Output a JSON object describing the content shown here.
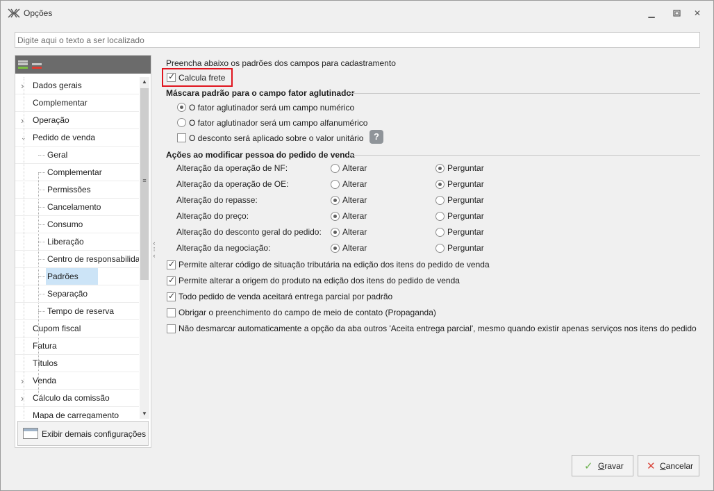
{
  "window": {
    "title": "Opções",
    "colors": {
      "accent_selection": "#cce4f7",
      "highlight_border": "#e0141e",
      "save_check": "#6ab04c",
      "cancel_x": "#d9463b"
    }
  },
  "search": {
    "placeholder": "Digite aqui o texto a ser localizado"
  },
  "tree": {
    "items": [
      {
        "label": "Dados gerais",
        "level": 0,
        "expandable": true
      },
      {
        "label": "Complementar",
        "level": 0,
        "expandable": false
      },
      {
        "label": "Operação",
        "level": 0,
        "expandable": true
      },
      {
        "label": "Pedido de venda",
        "level": 0,
        "expandable": true,
        "expanded": true
      },
      {
        "label": "Geral",
        "level": 1
      },
      {
        "label": "Complementar",
        "level": 1
      },
      {
        "label": "Permissões",
        "level": 1
      },
      {
        "label": "Cancelamento",
        "level": 1
      },
      {
        "label": "Consumo",
        "level": 1
      },
      {
        "label": "Liberação",
        "level": 1
      },
      {
        "label": "Centro de responsabilidade",
        "level": 1
      },
      {
        "label": "Padrões",
        "level": 1,
        "selected": true
      },
      {
        "label": "Separação",
        "level": 1
      },
      {
        "label": "Tempo de reserva",
        "level": 1
      },
      {
        "label": "Cupom fiscal",
        "level": 0
      },
      {
        "label": "Fatura",
        "level": 0
      },
      {
        "label": "Títulos",
        "level": 0
      },
      {
        "label": "Venda",
        "level": 0,
        "expandable": true
      },
      {
        "label": "Cálculo da comissão",
        "level": 0,
        "expandable": true
      },
      {
        "label": "Mapa de carregamento",
        "level": 0
      }
    ],
    "more_button": "Exibir demais configurações"
  },
  "main": {
    "intro": "Preencha abaixo os padrões dos campos para cadastramento",
    "calcula_frete": {
      "label": "Calcula frete",
      "checked": true
    },
    "mascara": {
      "title": "Máscara padrão para o campo fator aglutinador",
      "opt_numeric": {
        "label": "O fator aglutinador será um campo numérico",
        "checked": true
      },
      "opt_alpha": {
        "label": "O fator aglutinador será um campo alfanumérico",
        "checked": false
      },
      "desconto": {
        "label": "O desconto será aplicado sobre o valor unitário",
        "checked": false
      },
      "help": "?"
    },
    "acoes": {
      "title": "Ações ao modificar pessoa do pedido de venda",
      "alterar_label": "Alterar",
      "perguntar_label": "Perguntar",
      "rows": [
        {
          "label": "Alteração da operação de NF:",
          "choice": "Perguntar"
        },
        {
          "label": "Alteração da operação de OE:",
          "choice": "Perguntar"
        },
        {
          "label": "Alteração do repasse:",
          "choice": "Alterar"
        },
        {
          "label": "Alteração do preço:",
          "choice": "Alterar"
        },
        {
          "label": "Alteração do desconto geral do pedido:",
          "choice": "Alterar"
        },
        {
          "label": "Alteração da negociação:",
          "choice": "Alterar"
        }
      ]
    },
    "checks": [
      {
        "label": "Permite alterar código de situação tributária na edição dos itens do pedido de venda",
        "checked": true
      },
      {
        "label": "Permite alterar a origem do produto na edição dos itens do pedido de venda",
        "checked": true
      },
      {
        "label": "Todo pedido de venda aceitará entrega parcial por padrão",
        "checked": true
      },
      {
        "label": "Obrigar o preenchimento do campo de meio de contato (Propaganda)",
        "checked": false
      },
      {
        "label": "Não desmarcar automaticamente a opção da aba outros 'Aceita entrega parcial', mesmo quando existir apenas serviços nos itens do pedido",
        "checked": false
      }
    ]
  },
  "footer": {
    "save": {
      "icon": "check-icon",
      "prefix": "G",
      "rest": "ravar"
    },
    "cancel": {
      "icon": "x-icon",
      "prefix": "C",
      "rest": "ancelar"
    }
  }
}
